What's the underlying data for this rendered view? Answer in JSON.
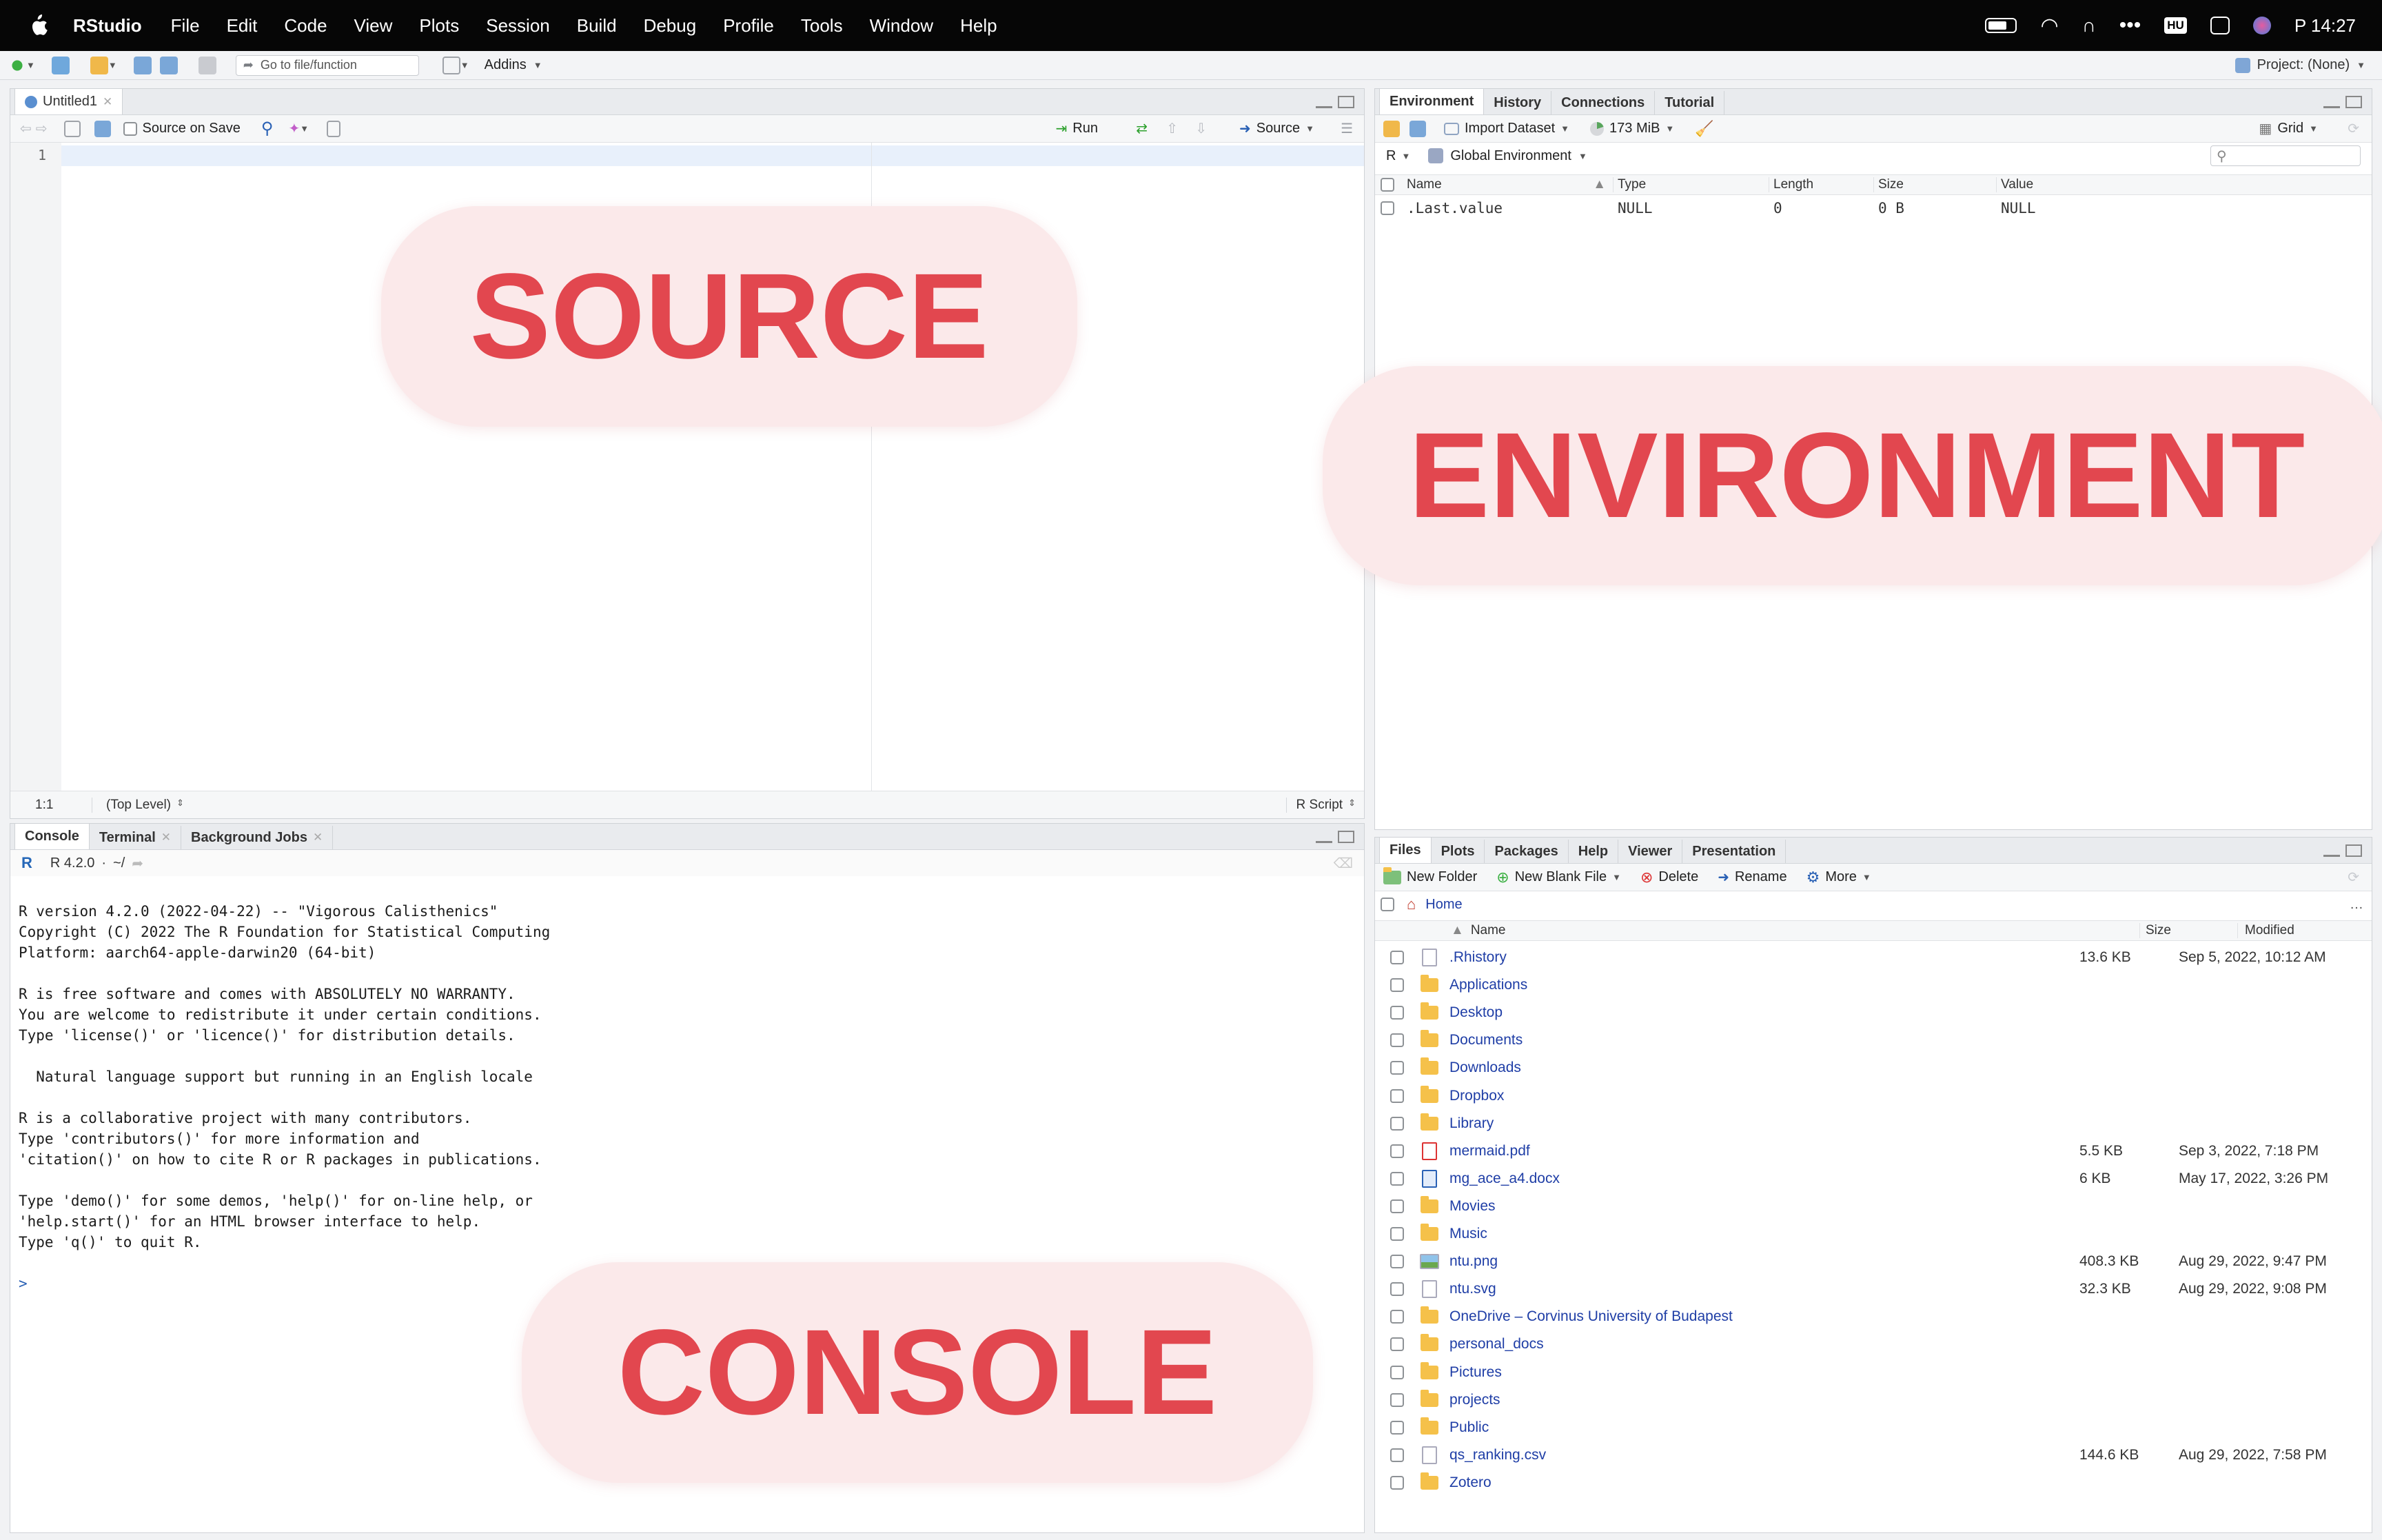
{
  "menubar": {
    "app": "RStudio",
    "items": [
      "File",
      "Edit",
      "Code",
      "View",
      "Plots",
      "Session",
      "Build",
      "Debug",
      "Profile",
      "Tools",
      "Window",
      "Help"
    ],
    "input_lang": "HU",
    "clock": "P  14:27"
  },
  "toolbar": {
    "goto_placeholder": "Go to file/function",
    "addins": "Addins",
    "project": "Project: (None)"
  },
  "source": {
    "tab": "Untitled1",
    "source_on_save": "Source on Save",
    "run": "Run",
    "source_btn": "Source",
    "line_no": "1",
    "status_pos": "1:1",
    "status_scope": "(Top Level)",
    "file_type": "R Script",
    "overlay": "SOURCE"
  },
  "console": {
    "tabs": [
      "Console",
      "Terminal",
      "Background Jobs"
    ],
    "version": "R 4.2.0",
    "path": "~/",
    "lines": [
      "R version 4.2.0 (2022-04-22) -- \"Vigorous Calisthenics\"",
      "Copyright (C) 2022 The R Foundation for Statistical Computing",
      "Platform: aarch64-apple-darwin20 (64-bit)",
      "",
      "R is free software and comes with ABSOLUTELY NO WARRANTY.",
      "You are welcome to redistribute it under certain conditions.",
      "Type 'license()' or 'licence()' for distribution details.",
      "",
      "  Natural language support but running in an English locale",
      "",
      "R is a collaborative project with many contributors.",
      "Type 'contributors()' for more information and",
      "'citation()' on how to cite R or R packages in publications.",
      "",
      "Type 'demo()' for some demos, 'help()' for on-line help, or",
      "'help.start()' for an HTML browser interface to help.",
      "Type 'q()' to quit R.",
      "",
      ">"
    ],
    "overlay": "CONSOLE"
  },
  "environment": {
    "tabs": [
      "Environment",
      "History",
      "Connections",
      "Tutorial"
    ],
    "import_dataset": "Import Dataset",
    "memory": "173 MiB",
    "grid": "Grid",
    "lang": "R",
    "scope": "Global Environment",
    "columns": [
      "Name",
      "Type",
      "Length",
      "Size",
      "Value"
    ],
    "rows": [
      {
        "name": ".Last.value",
        "type": "NULL",
        "length": "0",
        "size": "0 B",
        "value": "NULL"
      }
    ],
    "overlay": "ENVIRONMENT"
  },
  "files": {
    "tabs": [
      "Files",
      "Plots",
      "Packages",
      "Help",
      "Viewer",
      "Presentation"
    ],
    "new_folder": "New Folder",
    "new_blank": "New Blank File",
    "delete": "Delete",
    "rename": "Rename",
    "more": "More",
    "crumb": "Home",
    "columns": [
      "Name",
      "Size",
      "Modified"
    ],
    "rows": [
      {
        "name": ".Rhistory",
        "kind": "file",
        "size": "13.6 KB",
        "modified": "Sep 5, 2022, 10:12 AM"
      },
      {
        "name": "Applications",
        "kind": "folder",
        "size": "",
        "modified": ""
      },
      {
        "name": "Desktop",
        "kind": "folder",
        "size": "",
        "modified": ""
      },
      {
        "name": "Documents",
        "kind": "folder",
        "size": "",
        "modified": ""
      },
      {
        "name": "Downloads",
        "kind": "folder",
        "size": "",
        "modified": ""
      },
      {
        "name": "Dropbox",
        "kind": "folder",
        "size": "",
        "modified": ""
      },
      {
        "name": "Library",
        "kind": "folder",
        "size": "",
        "modified": ""
      },
      {
        "name": "mermaid.pdf",
        "kind": "pdf",
        "size": "5.5 KB",
        "modified": "Sep 3, 2022, 7:18 PM"
      },
      {
        "name": "mg_ace_a4.docx",
        "kind": "docx",
        "size": "6 KB",
        "modified": "May 17, 2022, 3:26 PM"
      },
      {
        "name": "Movies",
        "kind": "folder",
        "size": "",
        "modified": ""
      },
      {
        "name": "Music",
        "kind": "folder",
        "size": "",
        "modified": ""
      },
      {
        "name": "ntu.png",
        "kind": "image",
        "size": "408.3 KB",
        "modified": "Aug 29, 2022, 9:47 PM"
      },
      {
        "name": "ntu.svg",
        "kind": "file",
        "size": "32.3 KB",
        "modified": "Aug 29, 2022, 9:08 PM"
      },
      {
        "name": "OneDrive – Corvinus University of Budapest",
        "kind": "folder",
        "size": "",
        "modified": ""
      },
      {
        "name": "personal_docs",
        "kind": "folder",
        "size": "",
        "modified": ""
      },
      {
        "name": "Pictures",
        "kind": "folder",
        "size": "",
        "modified": ""
      },
      {
        "name": "projects",
        "kind": "folder",
        "size": "",
        "modified": ""
      },
      {
        "name": "Public",
        "kind": "folder",
        "size": "",
        "modified": ""
      },
      {
        "name": "qs_ranking.csv",
        "kind": "file",
        "size": "144.6 KB",
        "modified": "Aug 29, 2022, 7:58 PM"
      },
      {
        "name": "Zotero",
        "kind": "folder",
        "size": "",
        "modified": ""
      }
    ]
  }
}
